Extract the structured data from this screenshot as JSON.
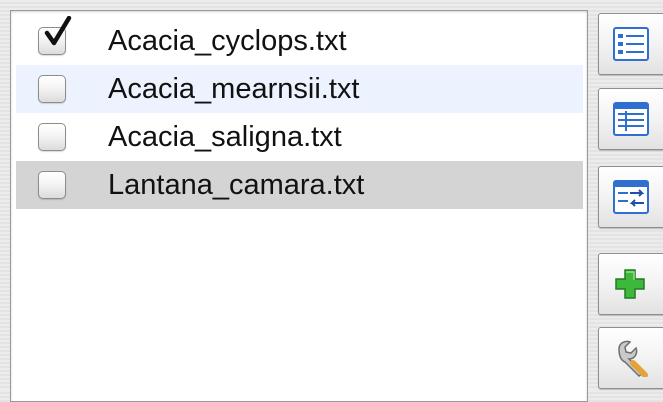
{
  "file_list": {
    "items": [
      {
        "label": "Acacia_cyclops.txt",
        "checked": true
      },
      {
        "label": "Acacia_mearnsii.txt",
        "checked": false
      },
      {
        "label": "Acacia_saligna.txt",
        "checked": false
      },
      {
        "label": "Lantana_camara.txt",
        "checked": false
      }
    ]
  },
  "toolbar": {
    "buttons": [
      {
        "icon": "checklist-icon"
      },
      {
        "icon": "list-icon"
      },
      {
        "icon": "swap-list-icon"
      },
      {
        "icon": "add-icon",
        "color": "#3db83a"
      },
      {
        "icon": "wrench-icon"
      }
    ]
  },
  "colors": {
    "selected_row": "#d4d4d4",
    "alternate_row": "#edf3fe",
    "list_icon_blue": "#2f6fd0"
  }
}
